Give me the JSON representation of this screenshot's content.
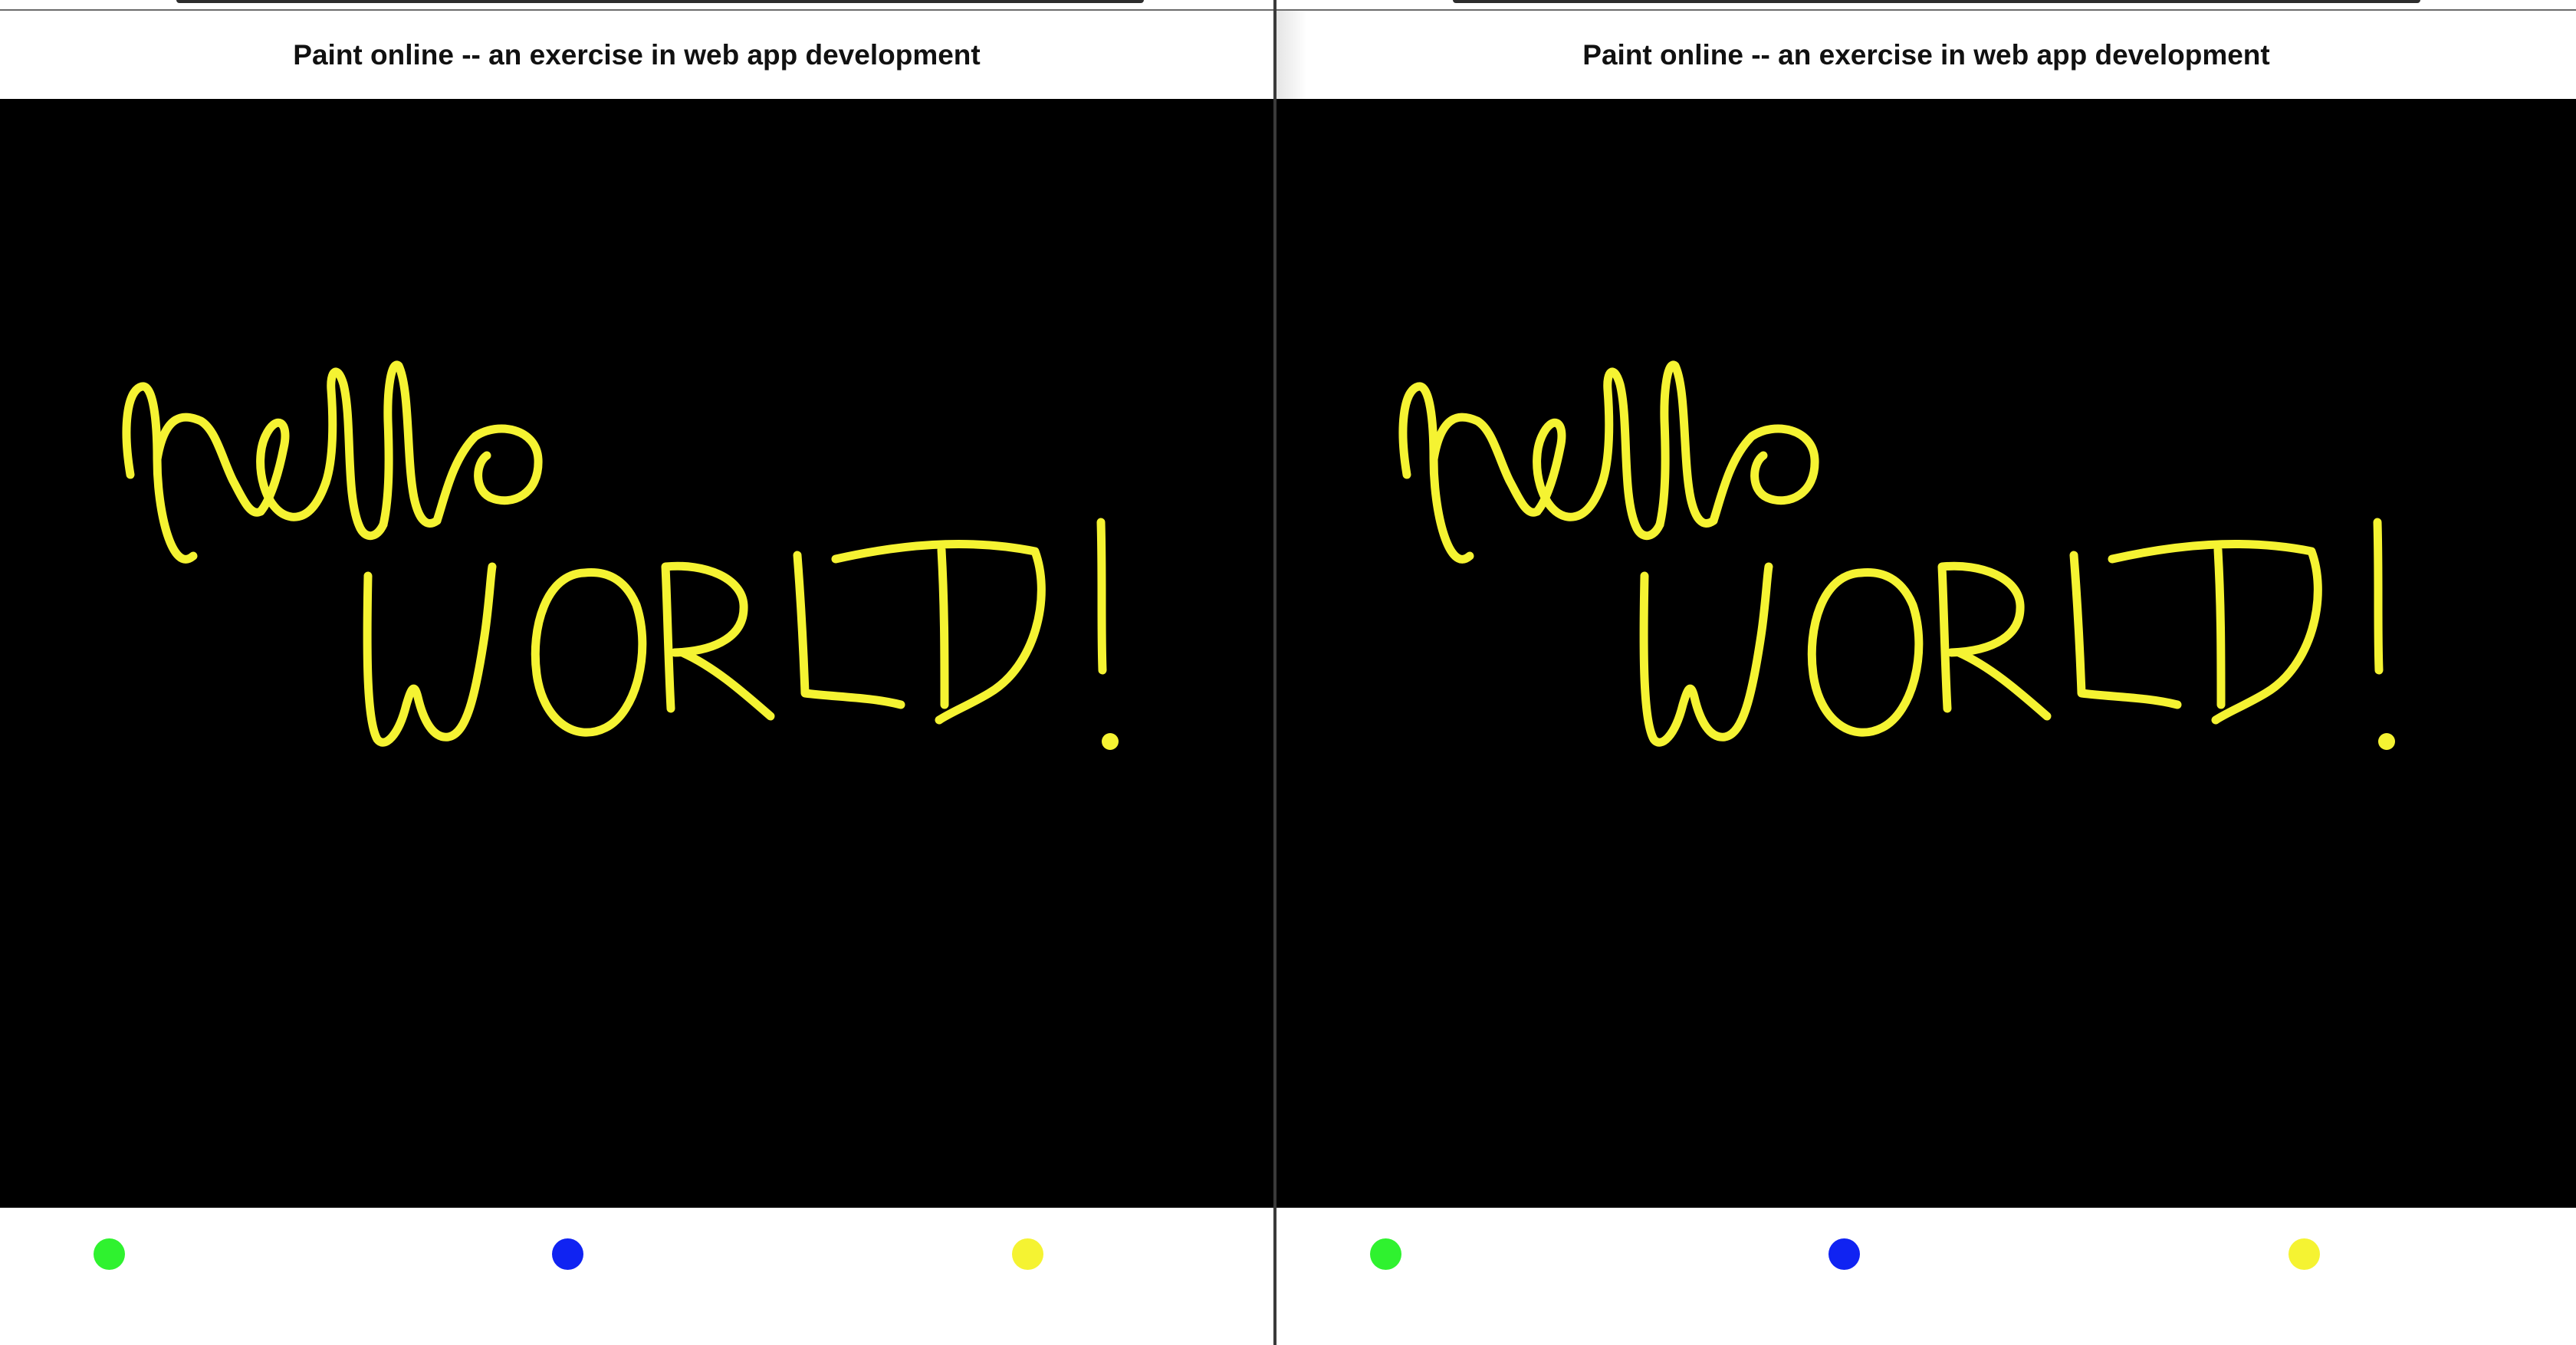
{
  "windows": [
    {
      "title": "Paint online -- an exercise in web app development",
      "canvas_background": "#000000",
      "stroke_color": "#f5f332",
      "drawing_text": "hello WORLD!",
      "palette": [
        {
          "name": "green",
          "color": "#2ff22f"
        },
        {
          "name": "blue",
          "color": "#1023f2"
        },
        {
          "name": "yellow",
          "color": "#f5f332"
        }
      ]
    },
    {
      "title": "Paint online -- an exercise in web app development",
      "canvas_background": "#000000",
      "stroke_color": "#f5f332",
      "drawing_text": "hello WORLD!",
      "palette": [
        {
          "name": "green",
          "color": "#2ff22f"
        },
        {
          "name": "blue",
          "color": "#1023f2"
        },
        {
          "name": "yellow",
          "color": "#f5f332"
        }
      ]
    }
  ]
}
